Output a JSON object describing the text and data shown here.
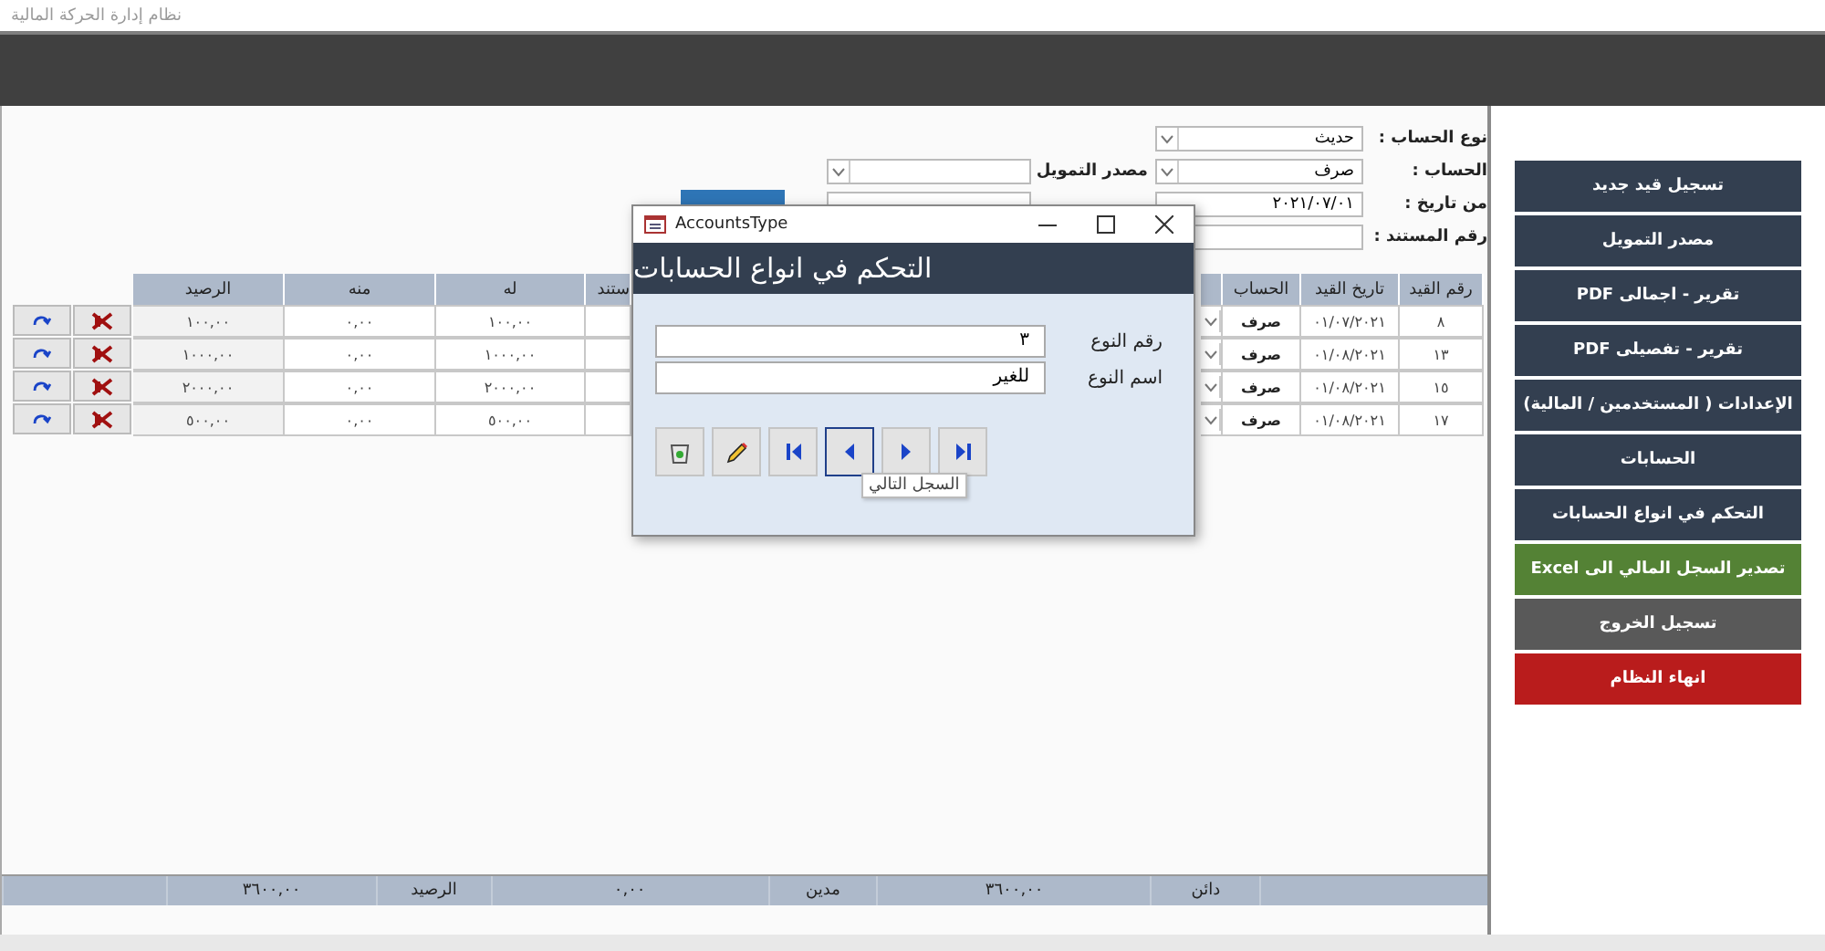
{
  "window": {
    "title": "نظام إدارة الحركة المالية"
  },
  "filters": {
    "account_type": {
      "label": "نوع الحساب :",
      "value": "حديث"
    },
    "account": {
      "label": "الحساب :",
      "value": "صرف"
    },
    "from_date": {
      "label": "من تاريخ :",
      "value": "٢٠٢١/٠٧/٠١"
    },
    "document_no": {
      "label": "رقم المستند :"
    },
    "funding_source": {
      "label": "مصدر التمويل"
    }
  },
  "table": {
    "right_columns": [
      "رقم القيد",
      "تاريخ القيد",
      "الحساب"
    ],
    "left_columns": [
      "ستند",
      "له",
      "منه",
      "الرصيد"
    ],
    "rows": [
      {
        "entry_no": "٨",
        "date": "٠١/٠٧/٢٠٢١",
        "account": "صرف",
        "credit": "١٠٠,٠٠",
        "debit": "٠,٠٠",
        "balance": "١٠٠,٠٠"
      },
      {
        "entry_no": "١٣",
        "date": "٠١/٠٨/٢٠٢١",
        "account": "صرف",
        "credit": "١٠٠٠,٠٠",
        "debit": "٠,٠٠",
        "balance": "١٠٠٠,٠٠"
      },
      {
        "entry_no": "١٥",
        "date": "٠١/٠٨/٢٠٢١",
        "account": "صرف",
        "credit": "٢٠٠٠,٠٠",
        "debit": "٠,٠٠",
        "balance": "٢٠٠٠,٠٠"
      },
      {
        "entry_no": "١٧",
        "date": "٠١/٠٨/٢٠٢١",
        "account": "صرف",
        "credit": "٥٠٠,٠٠",
        "debit": "٠,٠٠",
        "balance": "٥٠٠,٠٠"
      }
    ]
  },
  "status_bar": [
    {
      "label": "دائن",
      "value": "٣٦٠٠,٠٠"
    },
    {
      "label": "مدين",
      "value": "٠,٠٠"
    },
    {
      "label": "الرصيد",
      "value": "٣٦٠٠,٠٠"
    }
  ],
  "sidebar": [
    {
      "label": "تسجيل قيد جديد",
      "kind": "primary"
    },
    {
      "label": "مصدر التمويل",
      "kind": "primary"
    },
    {
      "label": "تقرير - اجمالى PDF",
      "kind": "primary"
    },
    {
      "label": "تقرير - تفصيلى PDF",
      "kind": "primary"
    },
    {
      "label": "الإعدادات ( المستخدمين / المالية)",
      "kind": "primary"
    },
    {
      "label": "الحسابات",
      "kind": "primary"
    },
    {
      "label": "التحكم في انواع الحسابات",
      "kind": "primary"
    },
    {
      "label": "تصدير السجل المالي الى Excel",
      "kind": "export"
    },
    {
      "label": "تسجيل الخروج",
      "kind": "logout"
    },
    {
      "label": "انهاء النظام",
      "kind": "exit"
    }
  ],
  "dialog": {
    "title": "AccountsType",
    "header": "التحكم في انواع الحسابات",
    "fields": [
      {
        "label": "رقم النوع",
        "value": "٣"
      },
      {
        "label": "اسم النوع",
        "value": "للغير"
      }
    ],
    "buttons": [
      {
        "kind": "delete",
        "focused": false
      },
      {
        "kind": "edit",
        "focused": false
      },
      {
        "kind": "first",
        "focused": false
      },
      {
        "kind": "previous",
        "focused": true
      },
      {
        "kind": "next",
        "focused": false
      },
      {
        "kind": "last",
        "focused": false
      }
    ],
    "tooltip": "السجل التالي"
  }
}
